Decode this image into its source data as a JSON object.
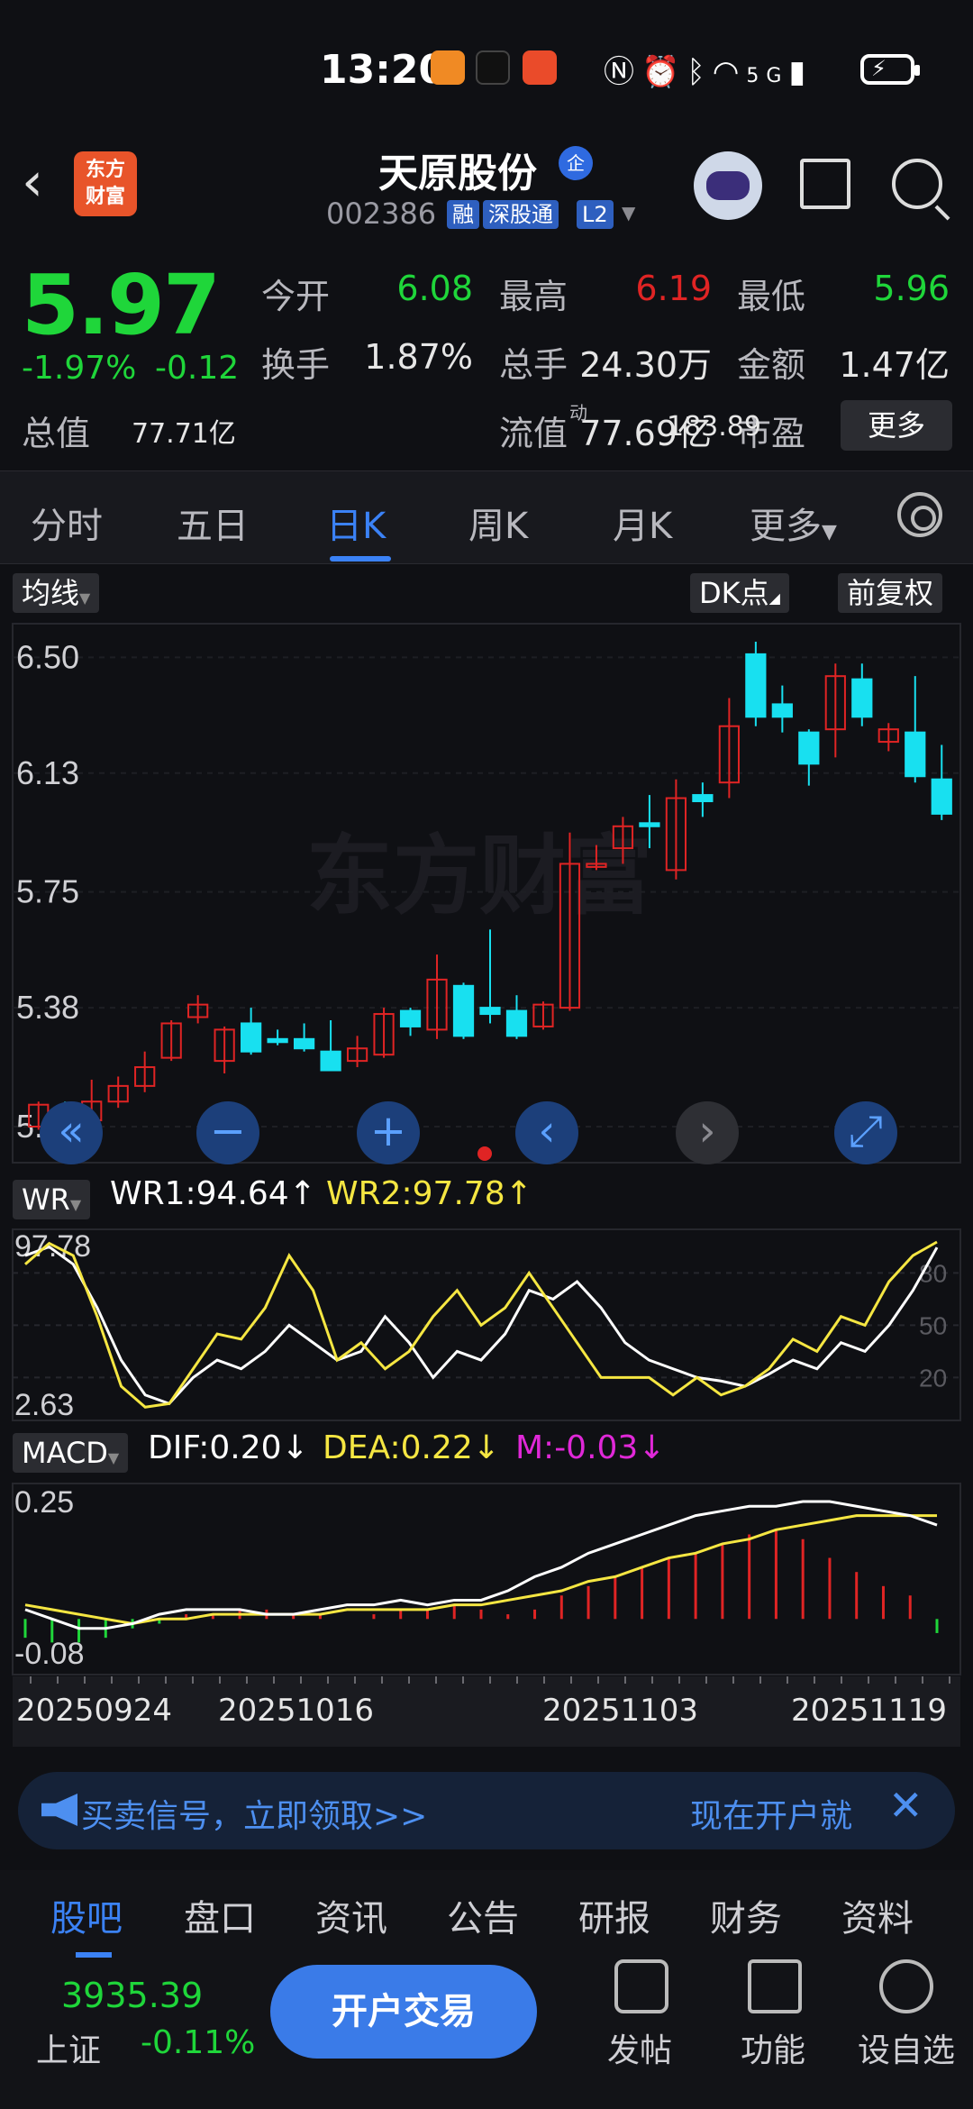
{
  "status_bar": {
    "time": "13:20",
    "network": "5G",
    "icons": [
      "app-orange-icon",
      "tiktok-icon",
      "app-red-icon",
      "nfc-icon",
      "alarm-icon",
      "bluetooth-icon",
      "wifi-icon",
      "signal-icon",
      "battery-charging-icon"
    ]
  },
  "header": {
    "logo_line1": "东方",
    "logo_line2": "财富",
    "stock_name": "天原股份",
    "badge": "企",
    "stock_code": "002386",
    "tags": [
      "融",
      "深股通",
      "L2"
    ]
  },
  "quote": {
    "price": "5.97",
    "change_pct": "-1.97%",
    "change_abs": "-0.12",
    "fields": [
      {
        "label": "今开",
        "value": "6.08",
        "color": "#1fd63a"
      },
      {
        "label": "最高",
        "value": "6.19",
        "color": "#e02424"
      },
      {
        "label": "最低",
        "value": "5.96",
        "color": "#1fd63a"
      },
      {
        "label": "换手",
        "value": "1.87%",
        "color": "#e6e6e6"
      },
      {
        "label": "总手",
        "value": "24.30万",
        "color": "#e6e6e6"
      },
      {
        "label": "金额",
        "value": "1.47亿",
        "color": "#e6e6e6"
      },
      {
        "label": "总值",
        "value": "77.71亿",
        "color": "#e6e6e6"
      },
      {
        "label": "流值",
        "value": "77.69亿",
        "color": "#e6e6e6"
      },
      {
        "label": "市盈",
        "value": "183.89",
        "color": "#e6e6e6"
      }
    ],
    "pe_superscript": "动",
    "more": "更多"
  },
  "tabs": [
    "分时",
    "五日",
    "日K",
    "周K",
    "月K",
    "更多"
  ],
  "active_tab": "日K",
  "chart_controls": {
    "ma_selector": "均线",
    "dk": "DK点",
    "adjust": "前复权",
    "watermark": "东方财富"
  },
  "chart_data": [
    {
      "type": "candlestick",
      "title": "",
      "y_ticks": [
        "6.50",
        "6.13",
        "5.75",
        "5.38",
        "5.00"
      ],
      "ylim": [
        5.0,
        6.55
      ],
      "candles": [
        {
          "o": 5.0,
          "c": 5.07,
          "h": 5.08,
          "l": 4.99
        },
        {
          "o": 5.06,
          "c": 5.0,
          "h": 5.08,
          "l": 4.99
        },
        {
          "o": 5.02,
          "c": 5.08,
          "h": 5.15,
          "l": 5.01
        },
        {
          "o": 5.08,
          "c": 5.13,
          "h": 5.16,
          "l": 5.06
        },
        {
          "o": 5.13,
          "c": 5.19,
          "h": 5.24,
          "l": 5.11
        },
        {
          "o": 5.22,
          "c": 5.33,
          "h": 5.34,
          "l": 5.21
        },
        {
          "o": 5.35,
          "c": 5.39,
          "h": 5.42,
          "l": 5.33
        },
        {
          "o": 5.21,
          "c": 5.31,
          "h": 5.32,
          "l": 5.17
        },
        {
          "o": 5.33,
          "c": 5.24,
          "h": 5.38,
          "l": 5.23
        },
        {
          "o": 5.28,
          "c": 5.27,
          "h": 5.31,
          "l": 5.26
        },
        {
          "o": 5.28,
          "c": 5.25,
          "h": 5.33,
          "l": 5.24
        },
        {
          "o": 5.24,
          "c": 5.18,
          "h": 5.34,
          "l": 5.18
        },
        {
          "o": 5.21,
          "c": 5.25,
          "h": 5.29,
          "l": 5.19
        },
        {
          "o": 5.23,
          "c": 5.36,
          "h": 5.38,
          "l": 5.22
        },
        {
          "o": 5.37,
          "c": 5.32,
          "h": 5.38,
          "l": 5.29
        },
        {
          "o": 5.31,
          "c": 5.47,
          "h": 5.55,
          "l": 5.28
        },
        {
          "o": 5.45,
          "c": 5.29,
          "h": 5.46,
          "l": 5.28
        },
        {
          "o": 5.38,
          "c": 5.36,
          "h": 5.63,
          "l": 5.33
        },
        {
          "o": 5.37,
          "c": 5.29,
          "h": 5.42,
          "l": 5.28
        },
        {
          "o": 5.32,
          "c": 5.39,
          "h": 5.4,
          "l": 5.31
        },
        {
          "o": 5.38,
          "c": 5.84,
          "h": 5.94,
          "l": 5.37
        },
        {
          "o": 5.83,
          "c": 5.84,
          "h": 5.9,
          "l": 5.82
        },
        {
          "o": 5.89,
          "c": 5.96,
          "h": 5.99,
          "l": 5.84
        },
        {
          "o": 5.97,
          "c": 5.96,
          "h": 6.06,
          "l": 5.89
        },
        {
          "o": 5.82,
          "c": 6.05,
          "h": 6.11,
          "l": 5.79
        },
        {
          "o": 6.06,
          "c": 6.04,
          "h": 6.1,
          "l": 5.99
        },
        {
          "o": 6.1,
          "c": 6.28,
          "h": 6.37,
          "l": 6.05
        },
        {
          "o": 6.51,
          "c": 6.31,
          "h": 6.55,
          "l": 6.28
        },
        {
          "o": 6.35,
          "c": 6.31,
          "h": 6.41,
          "l": 6.26
        },
        {
          "o": 6.26,
          "c": 6.16,
          "h": 6.27,
          "l": 6.09
        },
        {
          "o": 6.27,
          "c": 6.44,
          "h": 6.48,
          "l": 6.18
        },
        {
          "o": 6.43,
          "c": 6.31,
          "h": 6.48,
          "l": 6.28
        },
        {
          "o": 6.23,
          "c": 6.27,
          "h": 6.29,
          "l": 6.2
        },
        {
          "o": 6.26,
          "c": 6.12,
          "h": 6.44,
          "l": 6.1
        },
        {
          "o": 6.11,
          "c": 6.0,
          "h": 6.22,
          "l": 5.98
        }
      ]
    },
    {
      "type": "line",
      "name": "WR",
      "ylim": [
        2.63,
        97.78
      ],
      "y_ticks": [
        "97.78",
        "2.63"
      ],
      "right_ticks": [
        "80",
        "50",
        "20"
      ],
      "series": [
        {
          "name": "WR1",
          "color": "#ffffff",
          "values": [
            90,
            95,
            85,
            60,
            30,
            10,
            5,
            20,
            30,
            25,
            35,
            50,
            40,
            30,
            35,
            55,
            40,
            20,
            35,
            30,
            45,
            70,
            65,
            75,
            60,
            40,
            30,
            25,
            20,
            18,
            15,
            22,
            30,
            25,
            40,
            35,
            50,
            70,
            94.64
          ]
        },
        {
          "name": "WR2",
          "color": "#f5e642",
          "values": [
            85,
            97,
            90,
            55,
            15,
            3,
            5,
            25,
            45,
            42,
            60,
            90,
            70,
            30,
            40,
            25,
            35,
            55,
            70,
            50,
            60,
            80,
            60,
            40,
            20,
            20,
            20,
            10,
            20,
            10,
            15,
            25,
            42,
            35,
            55,
            50,
            75,
            90,
            97.78
          ]
        }
      ],
      "legend": {
        "wr1": "WR1:94.64",
        "wr2": "WR2:97.78"
      }
    },
    {
      "type": "bar",
      "name": "MACD",
      "ylim": [
        -0.08,
        0.25
      ],
      "y_ticks": [
        "0.25",
        "-0.08"
      ],
      "macd": [
        -0.04,
        -0.05,
        -0.05,
        -0.04,
        -0.02,
        -0.01,
        0.01,
        0.01,
        0.02,
        0.02,
        0.01,
        0.01,
        0.0,
        0.01,
        0.02,
        0.02,
        0.03,
        0.02,
        0.01,
        0.02,
        0.05,
        0.07,
        0.09,
        0.11,
        0.13,
        0.14,
        0.16,
        0.18,
        0.19,
        0.17,
        0.13,
        0.1,
        0.07,
        0.05,
        -0.03
      ],
      "dif": [
        0.02,
        0.0,
        -0.02,
        -0.02,
        -0.01,
        0.01,
        0.02,
        0.02,
        0.02,
        0.01,
        0.01,
        0.02,
        0.03,
        0.03,
        0.04,
        0.03,
        0.04,
        0.04,
        0.06,
        0.09,
        0.11,
        0.14,
        0.16,
        0.18,
        0.2,
        0.22,
        0.23,
        0.24,
        0.24,
        0.25,
        0.25,
        0.24,
        0.23,
        0.22,
        0.2
      ],
      "dea": [
        0.03,
        0.02,
        0.01,
        0.0,
        -0.01,
        0.0,
        0.0,
        0.01,
        0.01,
        0.01,
        0.01,
        0.01,
        0.02,
        0.02,
        0.02,
        0.02,
        0.03,
        0.03,
        0.04,
        0.05,
        0.06,
        0.08,
        0.09,
        0.11,
        0.13,
        0.14,
        0.16,
        0.17,
        0.19,
        0.2,
        0.21,
        0.22,
        0.22,
        0.22,
        0.22
      ],
      "legend": {
        "dif": "DIF:0.20",
        "dea": "DEA:0.22",
        "m": "M:-0.03"
      }
    }
  ],
  "x_dates": [
    "20250924",
    "20251016",
    "20251103",
    "20251119"
  ],
  "colors": {
    "up": "#e02424",
    "down": "#18e0f0",
    "accent": "#3b82f6",
    "green": "#1fd63a"
  },
  "promo": {
    "text": "买卖信号，立即领取>>",
    "right": "现在开户就"
  },
  "bottom_tabs": [
    "股吧",
    "盘口",
    "资讯",
    "公告",
    "研报",
    "财务",
    "资料"
  ],
  "footer": {
    "index_value": "3935.39",
    "index_name": "上证",
    "index_change": "-0.11%",
    "trade_button": "开户交易",
    "actions": [
      "发帖",
      "功能",
      "设自选"
    ]
  }
}
